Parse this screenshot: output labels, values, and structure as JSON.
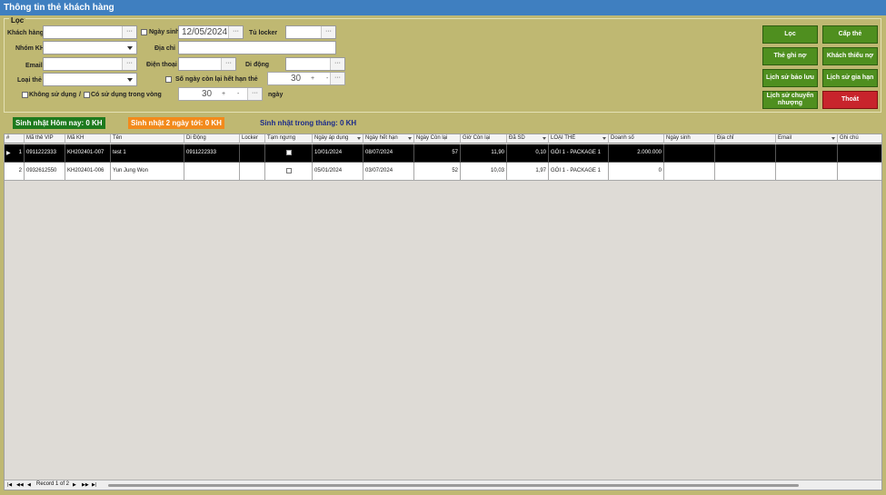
{
  "window": {
    "title": "Thông tin thẻ khách hàng"
  },
  "filter": {
    "legend": "Lọc",
    "labels": {
      "customer": "Khách hàng",
      "birthday": "Ngày sinh",
      "locker": "Tủ locker",
      "group": "Nhóm KH",
      "address": "Địa chỉ",
      "email": "Email",
      "phone": "Điện thoại",
      "mobile": "Di động",
      "card_type": "Loại thẻ",
      "days_left": "Số ngày còn lại hết hạn thẻ",
      "not_used": "Không sử dụng",
      "slash": "/",
      "used_within": "Có sử dụng trong vòng",
      "days_unit": "ngày"
    },
    "values": {
      "customer": "",
      "birthday": "12/05/2024",
      "locker": "",
      "group": "",
      "address": "",
      "email": "",
      "phone": "",
      "mobile": "",
      "card_type": "",
      "days_left": "30",
      "used_within": "30"
    },
    "spin_plus": "+",
    "spin_minus": "-",
    "ellipsis": "···"
  },
  "actions": {
    "filter": "Lọc",
    "issue_card": "Cấp thẻ",
    "debt_card": "Thẻ ghi nợ",
    "debt_customers": "Khách thiếu nợ",
    "reserve_history": "Lịch sử bảo lưu",
    "extend_history": "Lịch sử gia hạn",
    "transfer_history": "Lịch sử chuyển nhượng",
    "exit": "Thoát"
  },
  "birthdays": {
    "today": "Sinh nhật Hôm nay: 0 KH",
    "next_two_days": "Sinh nhật 2 ngày tới: 0 KH",
    "this_month": "Sinh nhật trong tháng: 0 KH"
  },
  "grid": {
    "columns": [
      "#",
      "Mã thẻ VIP",
      "Mã KH",
      "Tên",
      "Di Động",
      "Locker",
      "Tạm ngưng",
      "Ngày áp dụng",
      "Ngày hết hạn",
      "Ngày Còn lại",
      "Giờ Còn lại",
      "Đã SD",
      "LOẠI THẺ",
      "Doanh số",
      "Ngày sinh",
      "Địa chỉ",
      "Email",
      "Ghi chú"
    ],
    "rows": [
      {
        "no": "1",
        "vip": "0911222333",
        "code": "KH202401-007",
        "name": "test 1",
        "mobile": "0911222333",
        "locker": "",
        "start": "10/01/2024",
        "end": "08/07/2024",
        "days": "57",
        "hours": "11,90",
        "used": "0,10",
        "type": "GÓI 1 - PACKAGE 1",
        "revenue": "2.000.000",
        "dob": "",
        "address": "",
        "email": "",
        "note": ""
      },
      {
        "no": "2",
        "vip": "0932612550",
        "code": "KH202401-006",
        "name": "Yun Jung Won",
        "mobile": "",
        "locker": "",
        "start": "05/01/2024",
        "end": "03/07/2024",
        "days": "52",
        "hours": "10,03",
        "used": "1,97",
        "type": "GÓI 1 - PACKAGE 1",
        "revenue": "0",
        "dob": "",
        "address": "",
        "email": "",
        "note": ""
      }
    ],
    "navigator": {
      "record": "Record 1 of 2"
    }
  },
  "colors": {
    "title_bar": "#3f7fc0",
    "panel": "#bfb872",
    "green_button": "#4f8f1f",
    "exit_button": "#c8242c",
    "today_badge": "#1e7a1e",
    "two_days_badge": "#f28a1c",
    "month_text": "#1c2b8a"
  }
}
